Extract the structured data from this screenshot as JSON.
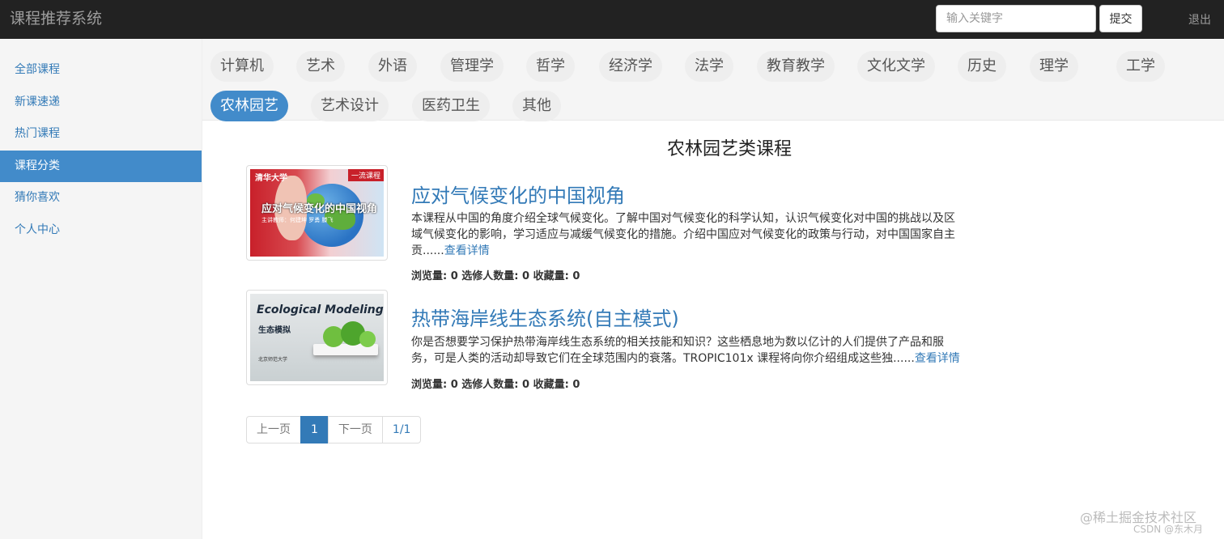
{
  "header": {
    "brand": "课程推荐系统",
    "search_placeholder": "输入关键字",
    "submit_label": "提交",
    "logout_label": "退出"
  },
  "sidebar": {
    "items": [
      {
        "label": "全部课程",
        "active": false
      },
      {
        "label": "新课速递",
        "active": false
      },
      {
        "label": "热门课程",
        "active": false
      },
      {
        "label": "课程分类",
        "active": true
      },
      {
        "label": "猜你喜欢",
        "active": false
      },
      {
        "label": "个人中心",
        "active": false
      }
    ]
  },
  "categories": {
    "row1": [
      "计算机",
      "艺术",
      "外语",
      "管理学",
      "哲学",
      "经济学",
      "法学",
      "教育教学",
      "文化文学",
      "历史",
      "理学",
      "工学"
    ],
    "row2": [
      "农林园艺",
      "艺术设计",
      "医药卫生",
      "其他"
    ],
    "active": "农林园艺"
  },
  "main": {
    "title": "农林园艺类课程",
    "courses": [
      {
        "title": "应对气候变化的中国视角",
        "description": "本课程从中国的角度介绍全球气候变化。了解中国对气候变化的科学认知，认识气候变化对中国的挑战以及区域气候变化的影响，学习适应与减缓气候变化的措施。介绍中国应对气候变化的政策与行动，对中国国家自主贡......",
        "detail_link": "查看详情",
        "stats": "浏览量: 0 选修人数量: 0 收藏量: 0",
        "thumb": {
          "badge": "一流课程",
          "caption": "应对气候变化的中国视角",
          "sub": "主讲教师：何建坤 罗勇 滕飞",
          "logo": "清华大学"
        }
      },
      {
        "title": "热带海岸线生态系统(自主模式)",
        "description": "你是否想要学习保护热带海岸线生态系统的相关技能和知识？这些栖息地为数以亿计的人们提供了产品和服务，可是人类的活动却导致它们在全球范围内的衰落。TROPIC101x 课程将向你介绍组成这些独......",
        "detail_link": "查看详情",
        "stats": "浏览量: 0 选修人数量: 0 收藏量: 0",
        "thumb": {
          "caption": "Ecological Modeling",
          "sub": "生态模拟",
          "footer": "北京师范大学"
        }
      }
    ]
  },
  "pagination": {
    "prev": "上一页",
    "current": "1",
    "next": "下一页",
    "total": "1/1"
  },
  "watermark": {
    "line1": "@稀土掘金技术社区",
    "line2": "CSDN @东木月"
  },
  "colors": {
    "navbar": "#222222",
    "accent": "#428bca",
    "link": "#337ab7",
    "sidebar_bg": "#f5f5f5"
  }
}
